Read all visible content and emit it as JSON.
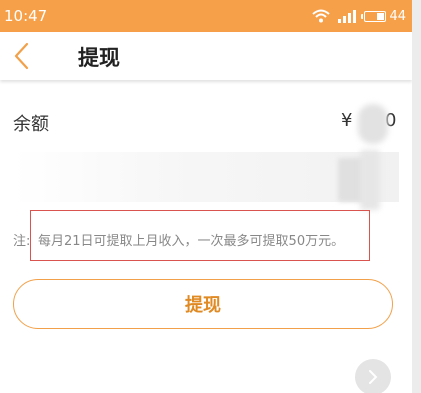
{
  "status_bar": {
    "time": "10:47",
    "battery_level": "44",
    "battery_fraction": 0.44,
    "icons": [
      "wifi-icon",
      "signal-icon",
      "battery-icon"
    ]
  },
  "nav": {
    "title": "提现",
    "back_icon": "chevron-left-icon"
  },
  "balance": {
    "label": "余额",
    "currency": "¥",
    "amount_visible_tail": "0"
  },
  "note": {
    "prefix": "注:",
    "text": "每月21日可提取上月收入，一次最多可提取50万元。"
  },
  "button": {
    "label": "提现"
  },
  "colors": {
    "status_bar_bg": "#f7a04a",
    "accent": "#e08a24",
    "button_border": "#f2a14a",
    "highlight_box": "#d9534f"
  }
}
